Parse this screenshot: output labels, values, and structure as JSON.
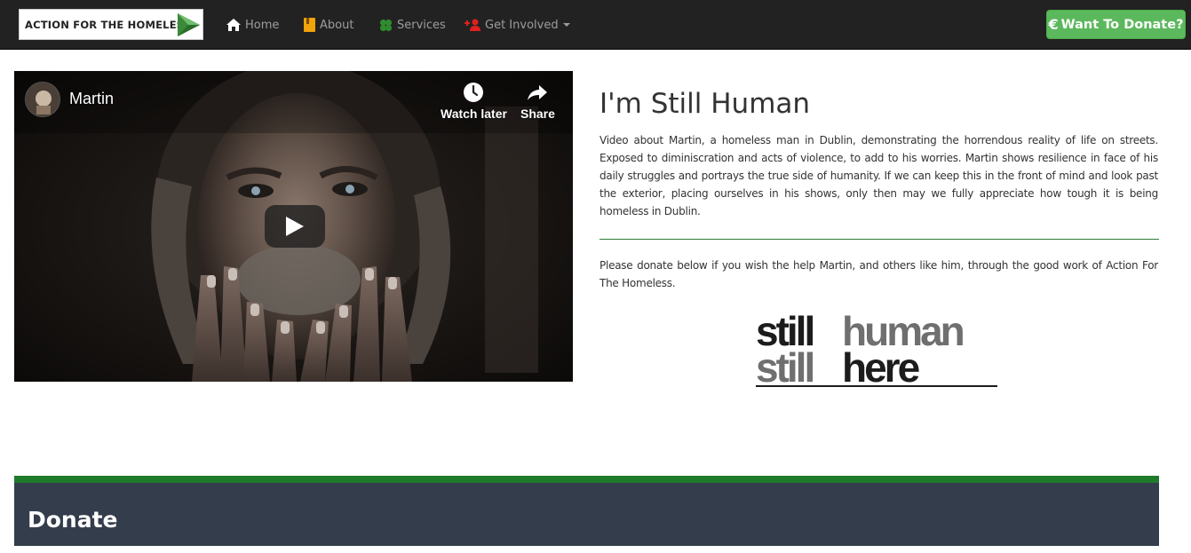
{
  "navbar": {
    "brand_text": "ACTION FOR THE HOMELESS",
    "items": [
      {
        "label": "Home",
        "icon": "home-icon",
        "icon_color": "#ffffff"
      },
      {
        "label": "About",
        "icon": "book-icon",
        "icon_color": "#f0a30a"
      },
      {
        "label": "Services",
        "icon": "clover-icon",
        "icon_color": "#2e8b2e"
      },
      {
        "label": "Get Involved",
        "icon": "add-user-icon",
        "icon_color": "#e02020"
      }
    ],
    "donate_button": {
      "symbol": "€",
      "label": "Want To Donate?",
      "color": "#5cb85c"
    }
  },
  "video": {
    "channel_title": "Martin",
    "watch_later_label": "Watch later",
    "share_label": "Share"
  },
  "content": {
    "heading": "I'm Still Human",
    "paragraph_1": "Video about Martin, a homeless man in Dublin, demonstrating the horrendous reality of life on streets. Exposed to diminiscration and acts of violence, to add to his worries. Martin shows resilience in face of his daily struggles and portrays the true side of humanity. If we can keep this in the front of mind and look past the exterior, placing ourselves in his shows, only then may we fully appreciate how tough it is being homeless in Dublin.",
    "paragraph_2": "Please donate below if you wish the help Martin, and others like him, through the good work of Action For The Homeless.",
    "divider_color": "#2e7d32",
    "logo": {
      "line1_dark": "still",
      "line1_light": "human",
      "line2_light": "still",
      "line2_dark": "here"
    }
  },
  "donate_section": {
    "title": "Donate",
    "accent_color": "#1e7b2c",
    "background_color": "#343d4c"
  }
}
